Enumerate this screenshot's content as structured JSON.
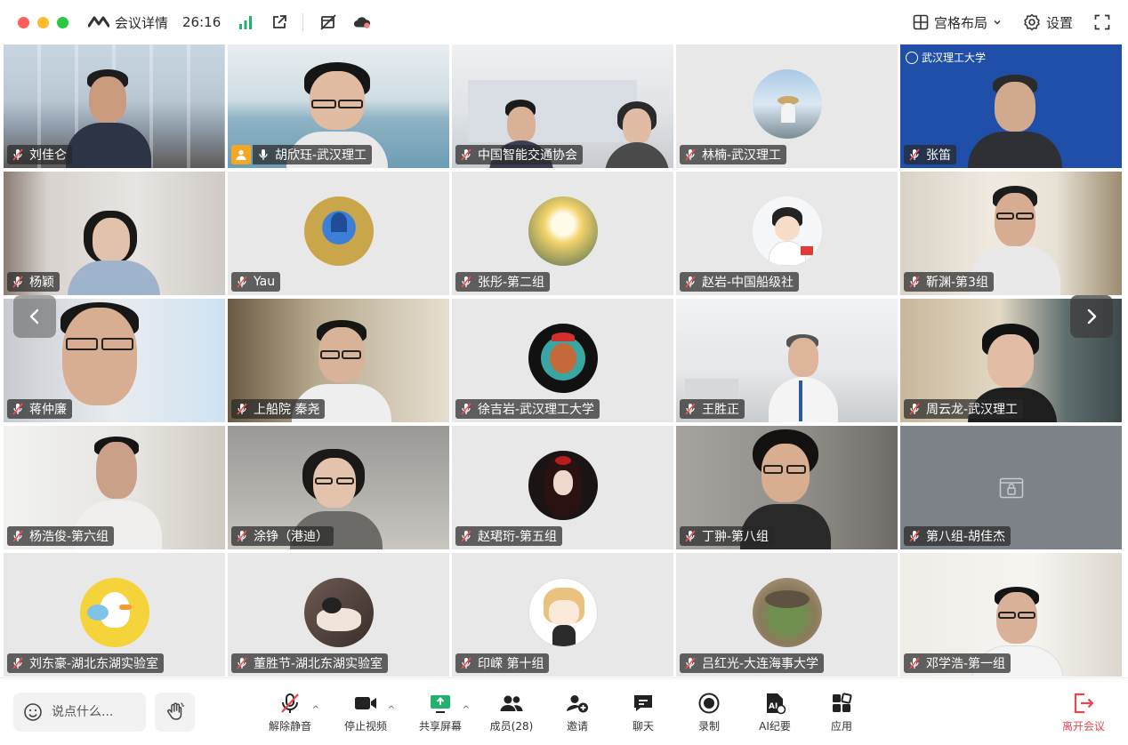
{
  "titlebar": {
    "title": "会议详情",
    "timer": "26:16",
    "layout_label": "宫格布局",
    "settings_label": "设置"
  },
  "participants": [
    {
      "name": "刘佳仑"
    },
    {
      "name": "胡欣珏-武汉理工",
      "host": true,
      "speaking": true
    },
    {
      "name": "中国智能交通协会"
    },
    {
      "name": "林楠-武汉理工"
    },
    {
      "name": "张笛"
    },
    {
      "name": "杨颖"
    },
    {
      "name": "Yau"
    },
    {
      "name": "张彤-第二组"
    },
    {
      "name": "赵岩-中国船级社"
    },
    {
      "name": "靳渊-第3组"
    },
    {
      "name": "蒋仲廉"
    },
    {
      "name": "上船院 秦尧"
    },
    {
      "name": "徐吉岩-武汉理工大学"
    },
    {
      "name": "王胜正"
    },
    {
      "name": "周云龙-武汉理工"
    },
    {
      "name": "杨浩俊-第六组"
    },
    {
      "name": "涂铮（港迪）"
    },
    {
      "name": "赵珺珩-第五组"
    },
    {
      "name": "丁翀-第八组"
    },
    {
      "name": "第八组-胡佳杰"
    },
    {
      "name": "刘东豪-湖北东湖实验室"
    },
    {
      "name": "董胜节-湖北东湖实验室"
    },
    {
      "name": "印嵘 第十组"
    },
    {
      "name": "吕红光-大连海事大学"
    },
    {
      "name": "邓学浩-第一组"
    }
  ],
  "university_banner": "武汉理工大学",
  "toolbar": {
    "say_placeholder": "说点什么...",
    "unmute": "解除静音",
    "stop_video": "停止视频",
    "share_screen": "共享屏幕",
    "members": "成员(28)",
    "invite": "邀请",
    "chat": "聊天",
    "record": "录制",
    "ai_minutes": "AI纪要",
    "apps": "应用",
    "leave": "离开会议"
  },
  "colors": {
    "active_speaker_border": "#3ccb7f",
    "leave_red": "#e5484d",
    "host_badge": "#f5a623",
    "share_green": "#23b26d"
  }
}
